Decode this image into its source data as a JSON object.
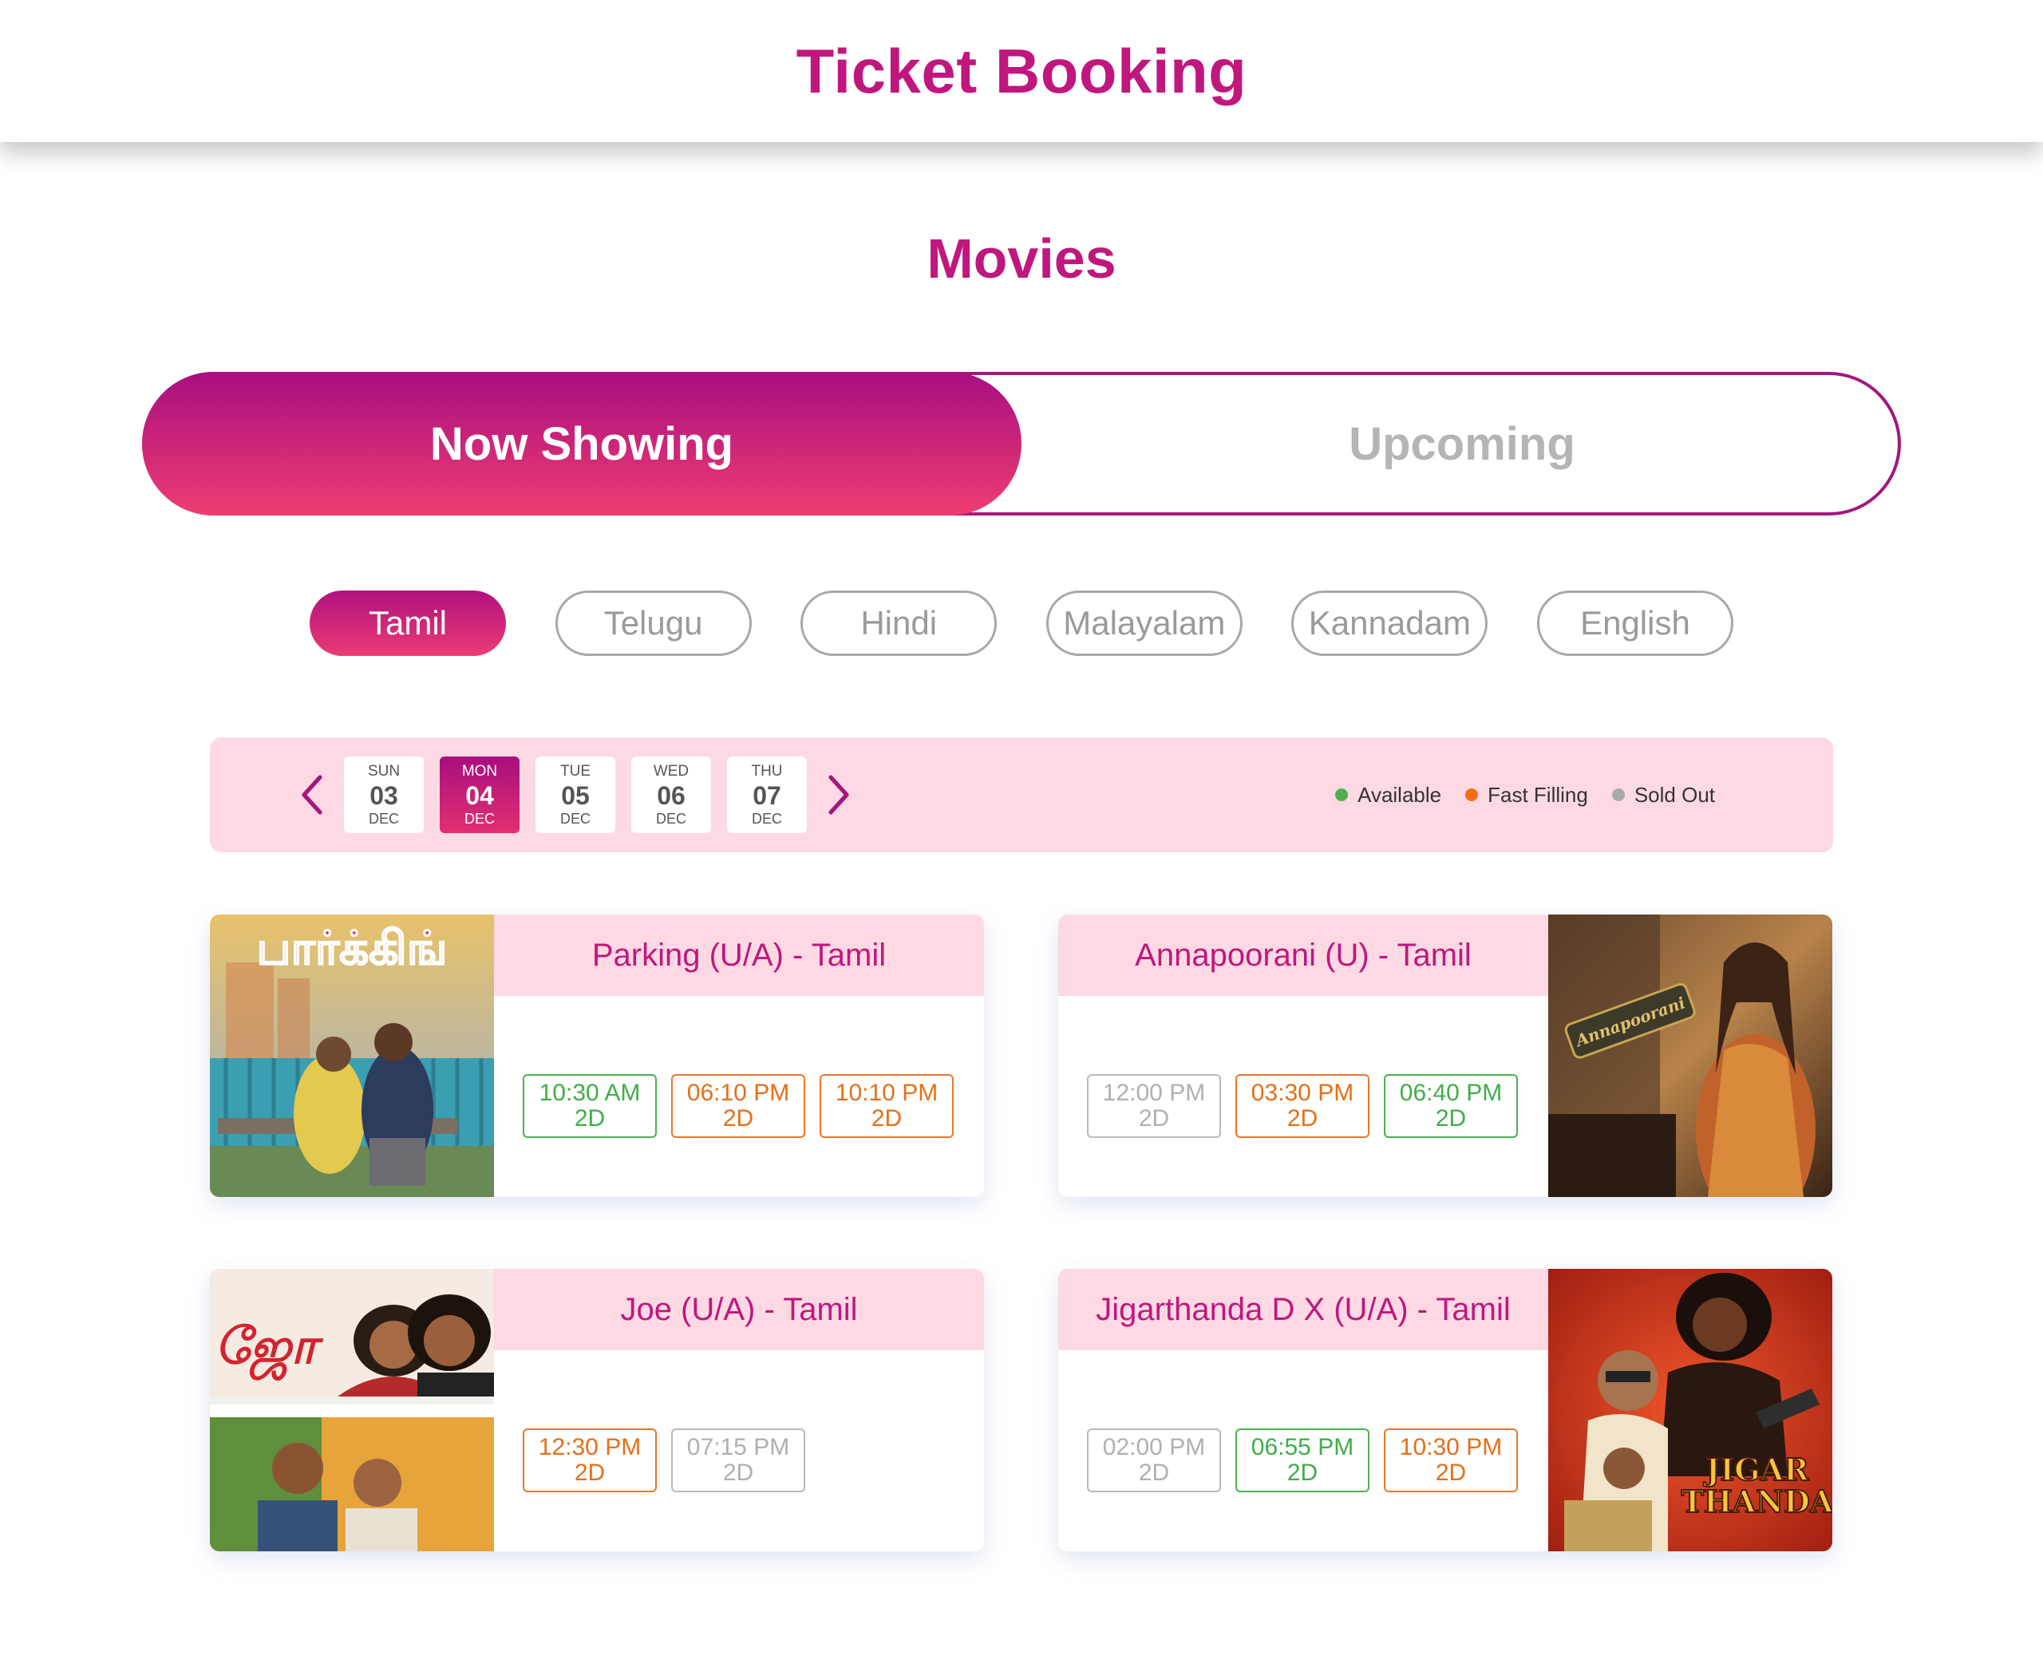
{
  "header": {
    "title": "Ticket Booking"
  },
  "section": {
    "title": "Movies"
  },
  "tabs": {
    "active": "Now Showing",
    "inactive": "Upcoming"
  },
  "languages": [
    {
      "label": "Tamil",
      "selected": true
    },
    {
      "label": "Telugu",
      "selected": false
    },
    {
      "label": "Hindi",
      "selected": false
    },
    {
      "label": "Malayalam",
      "selected": false
    },
    {
      "label": "Kannadam",
      "selected": false
    },
    {
      "label": "English",
      "selected": false
    }
  ],
  "dates": [
    {
      "dow": "SUN",
      "day": "03",
      "month": "DEC",
      "selected": false
    },
    {
      "dow": "MON",
      "day": "04",
      "month": "DEC",
      "selected": true
    },
    {
      "dow": "TUE",
      "day": "05",
      "month": "DEC",
      "selected": false
    },
    {
      "dow": "WED",
      "day": "06",
      "month": "DEC",
      "selected": false
    },
    {
      "dow": "THU",
      "day": "07",
      "month": "DEC",
      "selected": false
    }
  ],
  "legend": {
    "available": {
      "label": "Available",
      "color": "#4caf50"
    },
    "fast": {
      "label": "Fast Filling",
      "color": "#f36c16"
    },
    "soldout": {
      "label": "Sold Out",
      "color": "#a9a9a9"
    }
  },
  "movies": [
    {
      "title": "Parking (U/A) - Tamil",
      "poster": "parking-poster",
      "poster_text": "பார்க்கிங்",
      "shows": [
        {
          "time": "10:30 AM",
          "format": "2D",
          "status": "available"
        },
        {
          "time": "06:10 PM",
          "format": "2D",
          "status": "fast"
        },
        {
          "time": "10:10 PM",
          "format": "2D",
          "status": "fast"
        }
      ]
    },
    {
      "title": "Annapoorani (U) - Tamil",
      "poster": "annapoorani-poster",
      "poster_text": "Annapoorani",
      "shows": [
        {
          "time": "12:00 PM",
          "format": "2D",
          "status": "soldout"
        },
        {
          "time": "03:30 PM",
          "format": "2D",
          "status": "fast"
        },
        {
          "time": "06:40 PM",
          "format": "2D",
          "status": "available"
        }
      ]
    },
    {
      "title": "Joe (U/A) - Tamil",
      "poster": "joe-poster",
      "poster_text": "ஜோ",
      "shows": [
        {
          "time": "12:30 PM",
          "format": "2D",
          "status": "fast"
        },
        {
          "time": "07:15 PM",
          "format": "2D",
          "status": "soldout"
        }
      ]
    },
    {
      "title": "Jigarthanda D X (U/A)  - Tamil",
      "poster": "jigarthanda-poster",
      "poster_text": "JIGAR THANDA",
      "shows": [
        {
          "time": "02:00 PM",
          "format": "2D",
          "status": "soldout"
        },
        {
          "time": "06:55 PM",
          "format": "2D",
          "status": "available"
        },
        {
          "time": "10:30 PM",
          "format": "2D",
          "status": "fast"
        }
      ]
    }
  ]
}
